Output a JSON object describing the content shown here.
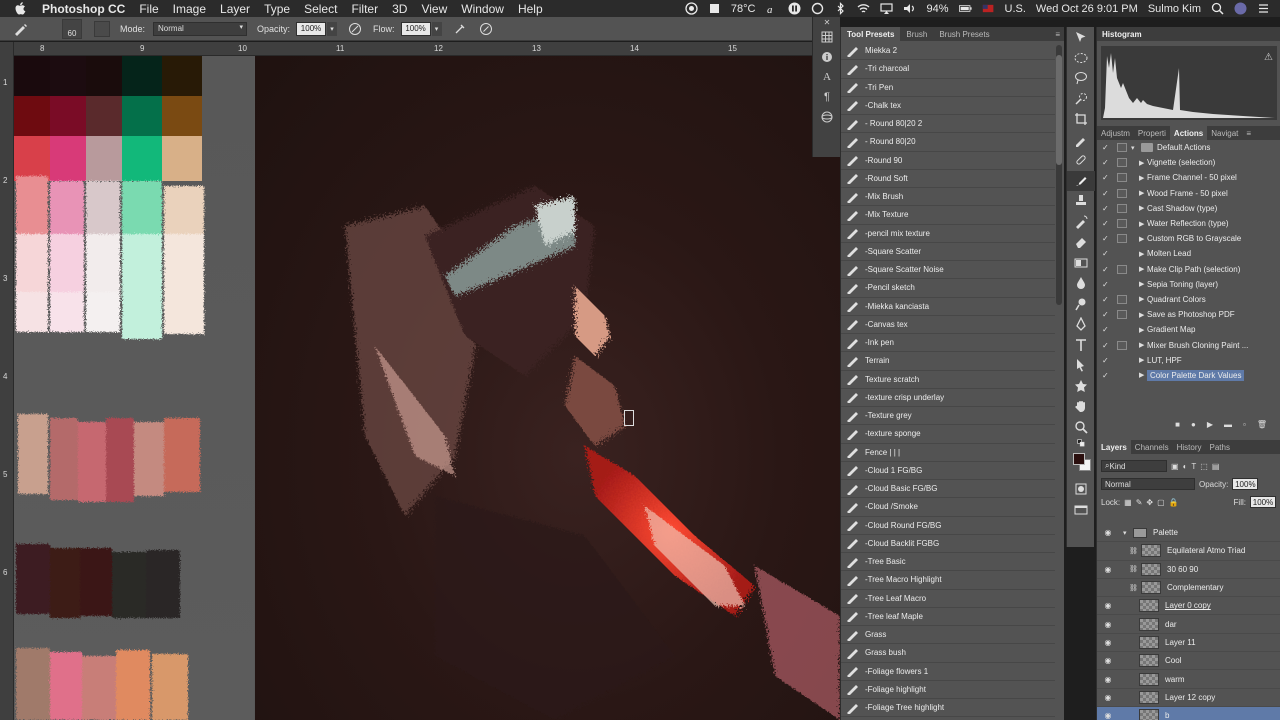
{
  "menubar": {
    "app": "Photoshop CC",
    "menus": [
      "File",
      "Image",
      "Layer",
      "Type",
      "Select",
      "Filter",
      "3D",
      "View",
      "Window",
      "Help"
    ],
    "temp": "78°C",
    "battery": "94%",
    "locale": "U.S.",
    "datetime": "Wed Oct 26  9:01 PM",
    "user": "Sulmo Kim"
  },
  "options": {
    "brush_size": "60",
    "mode_label": "Mode:",
    "mode_value": "Normal",
    "opacity_label": "Opacity:",
    "opacity_value": "100%",
    "flow_label": "Flow:",
    "flow_value": "100%"
  },
  "ruler": {
    "top_ticks": [
      "8",
      "9",
      "10",
      "11",
      "12",
      "13",
      "14",
      "15"
    ],
    "left_ticks": [
      "1",
      "2",
      "3",
      "4",
      "5",
      "6"
    ]
  },
  "preset_tabs": [
    "Tool Presets",
    "Brush",
    "Brush Presets"
  ],
  "presets": [
    "Miekka 2",
    "-Tri charcoal",
    "-Tri Pen",
    "-Chalk tex",
    "- Round 80|20 2",
    "- Round 80|20",
    "-Round  90",
    "-Round Soft",
    "-Mix Brush",
    "-Mix Texture",
    "-pencil mix texture",
    "-Square Scatter",
    "-Square Scatter Noise",
    "-Pencil sketch",
    "-Miekka kanciasta",
    "-Canvas tex",
    "-Ink pen",
    "Terrain",
    "Texture scratch",
    "-texture crisp underlay",
    "-Texture grey",
    "-texture sponge",
    "Fence | | |",
    "-Cloud 1 FG/BG",
    "-Cloud Basic FG/BG",
    "-Cloud /Smoke",
    "-Cloud Round FG/BG",
    "-Cloud Backlit FGBG",
    "-Tree Basic",
    "-Tree Macro Highlight",
    "-Tree Leaf Macro",
    "-Tree leaf Maple",
    "Grass",
    "Grass bush",
    "-Foliage flowers 1",
    "-Foliage highlight",
    "-Foliage Tree highlight"
  ],
  "histogram": {
    "title": "Histogram"
  },
  "actions_tabs": [
    "Adjustm",
    "Properti",
    "Actions",
    "Navigat"
  ],
  "actions": {
    "folder": "Default Actions",
    "items": [
      "Vignette (selection)",
      "Frame Channel - 50 pixel",
      "Wood Frame - 50 pixel",
      "Cast Shadow (type)",
      "Water Reflection (type)",
      "Custom RGB to Grayscale",
      "Molten Lead",
      "Make Clip Path (selection)",
      "Sepia Toning (layer)",
      "Quadrant Colors",
      "Save as Photoshop PDF",
      "Gradient Map",
      "Mixer Brush Cloning Paint ...",
      "LUT, HPF",
      "Color Palette Dark Values"
    ]
  },
  "layers_tabs": [
    "Layers",
    "Channels",
    "History",
    "Paths"
  ],
  "layers": {
    "kind_label": "Kind",
    "blend_mode": "Normal",
    "opacity_label": "Opacity:",
    "opacity_value": "100%",
    "lock_label": "Lock:",
    "fill_label": "Fill:",
    "fill_value": "100%",
    "items": [
      "Palette",
      "Equilateral Atmo Triad",
      "30 60 90",
      "Complementary",
      "Layer 0 copy",
      "dar",
      "Layer 11",
      "Cool",
      "warm",
      "Layer 12 copy",
      "b"
    ]
  }
}
